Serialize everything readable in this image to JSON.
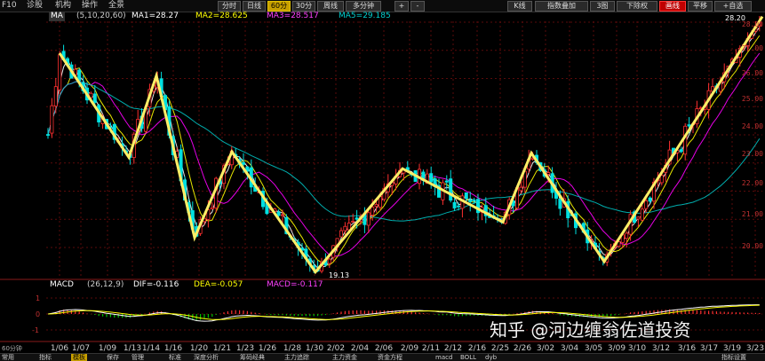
{
  "topbar": {
    "left_items": [
      "F10",
      "诊股",
      "机构",
      "操作",
      "全景"
    ],
    "period_buttons": [
      "分时",
      "日线",
      "60分",
      "30分",
      "周线",
      "多分钟"
    ],
    "active_period": "60分",
    "extra_buttons": [
      "+",
      "-"
    ],
    "right_buttons": [
      "K线",
      "指数叠加",
      "3图",
      "下除权",
      "画线",
      "平移",
      "+自选"
    ],
    "active_right": "画线"
  },
  "ma_legend": {
    "indicator": "MA",
    "params": "(5,10,20,60)",
    "ma1": "MA1=28.27",
    "ma2": "MA2=28.625",
    "ma3": "MA3=28.517",
    "ma5": "MA5=29.185",
    "colors": {
      "ma1": "#ffffff",
      "ma2": "#ffff00",
      "ma3": "#ff00ff",
      "ma5": "#00c0c0"
    }
  },
  "price_axis": {
    "ticks": [
      "28.00",
      "27.00",
      "26.00",
      "25.00",
      "24.00",
      "23.00",
      "22.00",
      "21.00",
      "20.00"
    ],
    "high_label": "28.20",
    "low_label": "19.13"
  },
  "macd_legend": {
    "indicator": "MACD",
    "params": "(26,12,9)",
    "dif": "DIF=-0.116",
    "dea": "DEA=-0.057",
    "macd": "MACD=-0.117",
    "colors": {
      "dif": "#ffffff",
      "dea": "#ffff00",
      "macd": "#ff00ff"
    }
  },
  "macd_axis": {
    "ticks": [
      "1",
      "0",
      "-1"
    ]
  },
  "x_axis": {
    "labels": [
      "1/06",
      "1/07",
      "1/09",
      "1/13",
      "1/14",
      "1/16",
      "1/20",
      "1/21",
      "1/23",
      "1/26",
      "1/28",
      "1/30",
      "2/02",
      "2/04",
      "2/06",
      "2/09",
      "2/11",
      "2/12",
      "2/16",
      "2/25",
      "2/26",
      "3/02",
      "3/04",
      "3/05",
      "3/09",
      "3/10",
      "3/12",
      "3/16",
      "3/17",
      "3/19",
      "3/23"
    ]
  },
  "corner_label": "60分钟",
  "bottombar": {
    "items": [
      "常用",
      "指标",
      "模板",
      "保存",
      "管理",
      "标准",
      "深度分析",
      "筹码经典",
      "主力追踪",
      "主力资金",
      "资金方程",
      "macd",
      "BOLL",
      "dyb",
      "指标设置"
    ],
    "active": "模板"
  },
  "watermark": "知乎 @河边缠翁佐道投资",
  "colors": {
    "up": "#ff3030",
    "down": "#00e0e0",
    "zigzag": "#ffee66",
    "grid": "#5a0a0a"
  },
  "chart_data": {
    "type": "candlestick",
    "price_range": [
      19.13,
      28.2
    ],
    "price_ticks": [
      20,
      21,
      22,
      23,
      24,
      25,
      26,
      27,
      28
    ],
    "zigzag_pivots": [
      {
        "x": "1/06",
        "price": 26.9
      },
      {
        "x": "1/13",
        "price": 23.2
      },
      {
        "x": "1/14",
        "price": 26.1
      },
      {
        "x": "1/20",
        "price": 20.35
      },
      {
        "x": "1/21",
        "price": 23.4
      },
      {
        "x": "1/30",
        "price": 19.13
      },
      {
        "x": "2/09",
        "price": 22.8
      },
      {
        "x": "2/25",
        "price": 20.9
      },
      {
        "x": "2/26",
        "price": 23.35
      },
      {
        "x": "3/05",
        "price": 19.5
      },
      {
        "x": "3/23",
        "price": 28.2
      }
    ]
  }
}
